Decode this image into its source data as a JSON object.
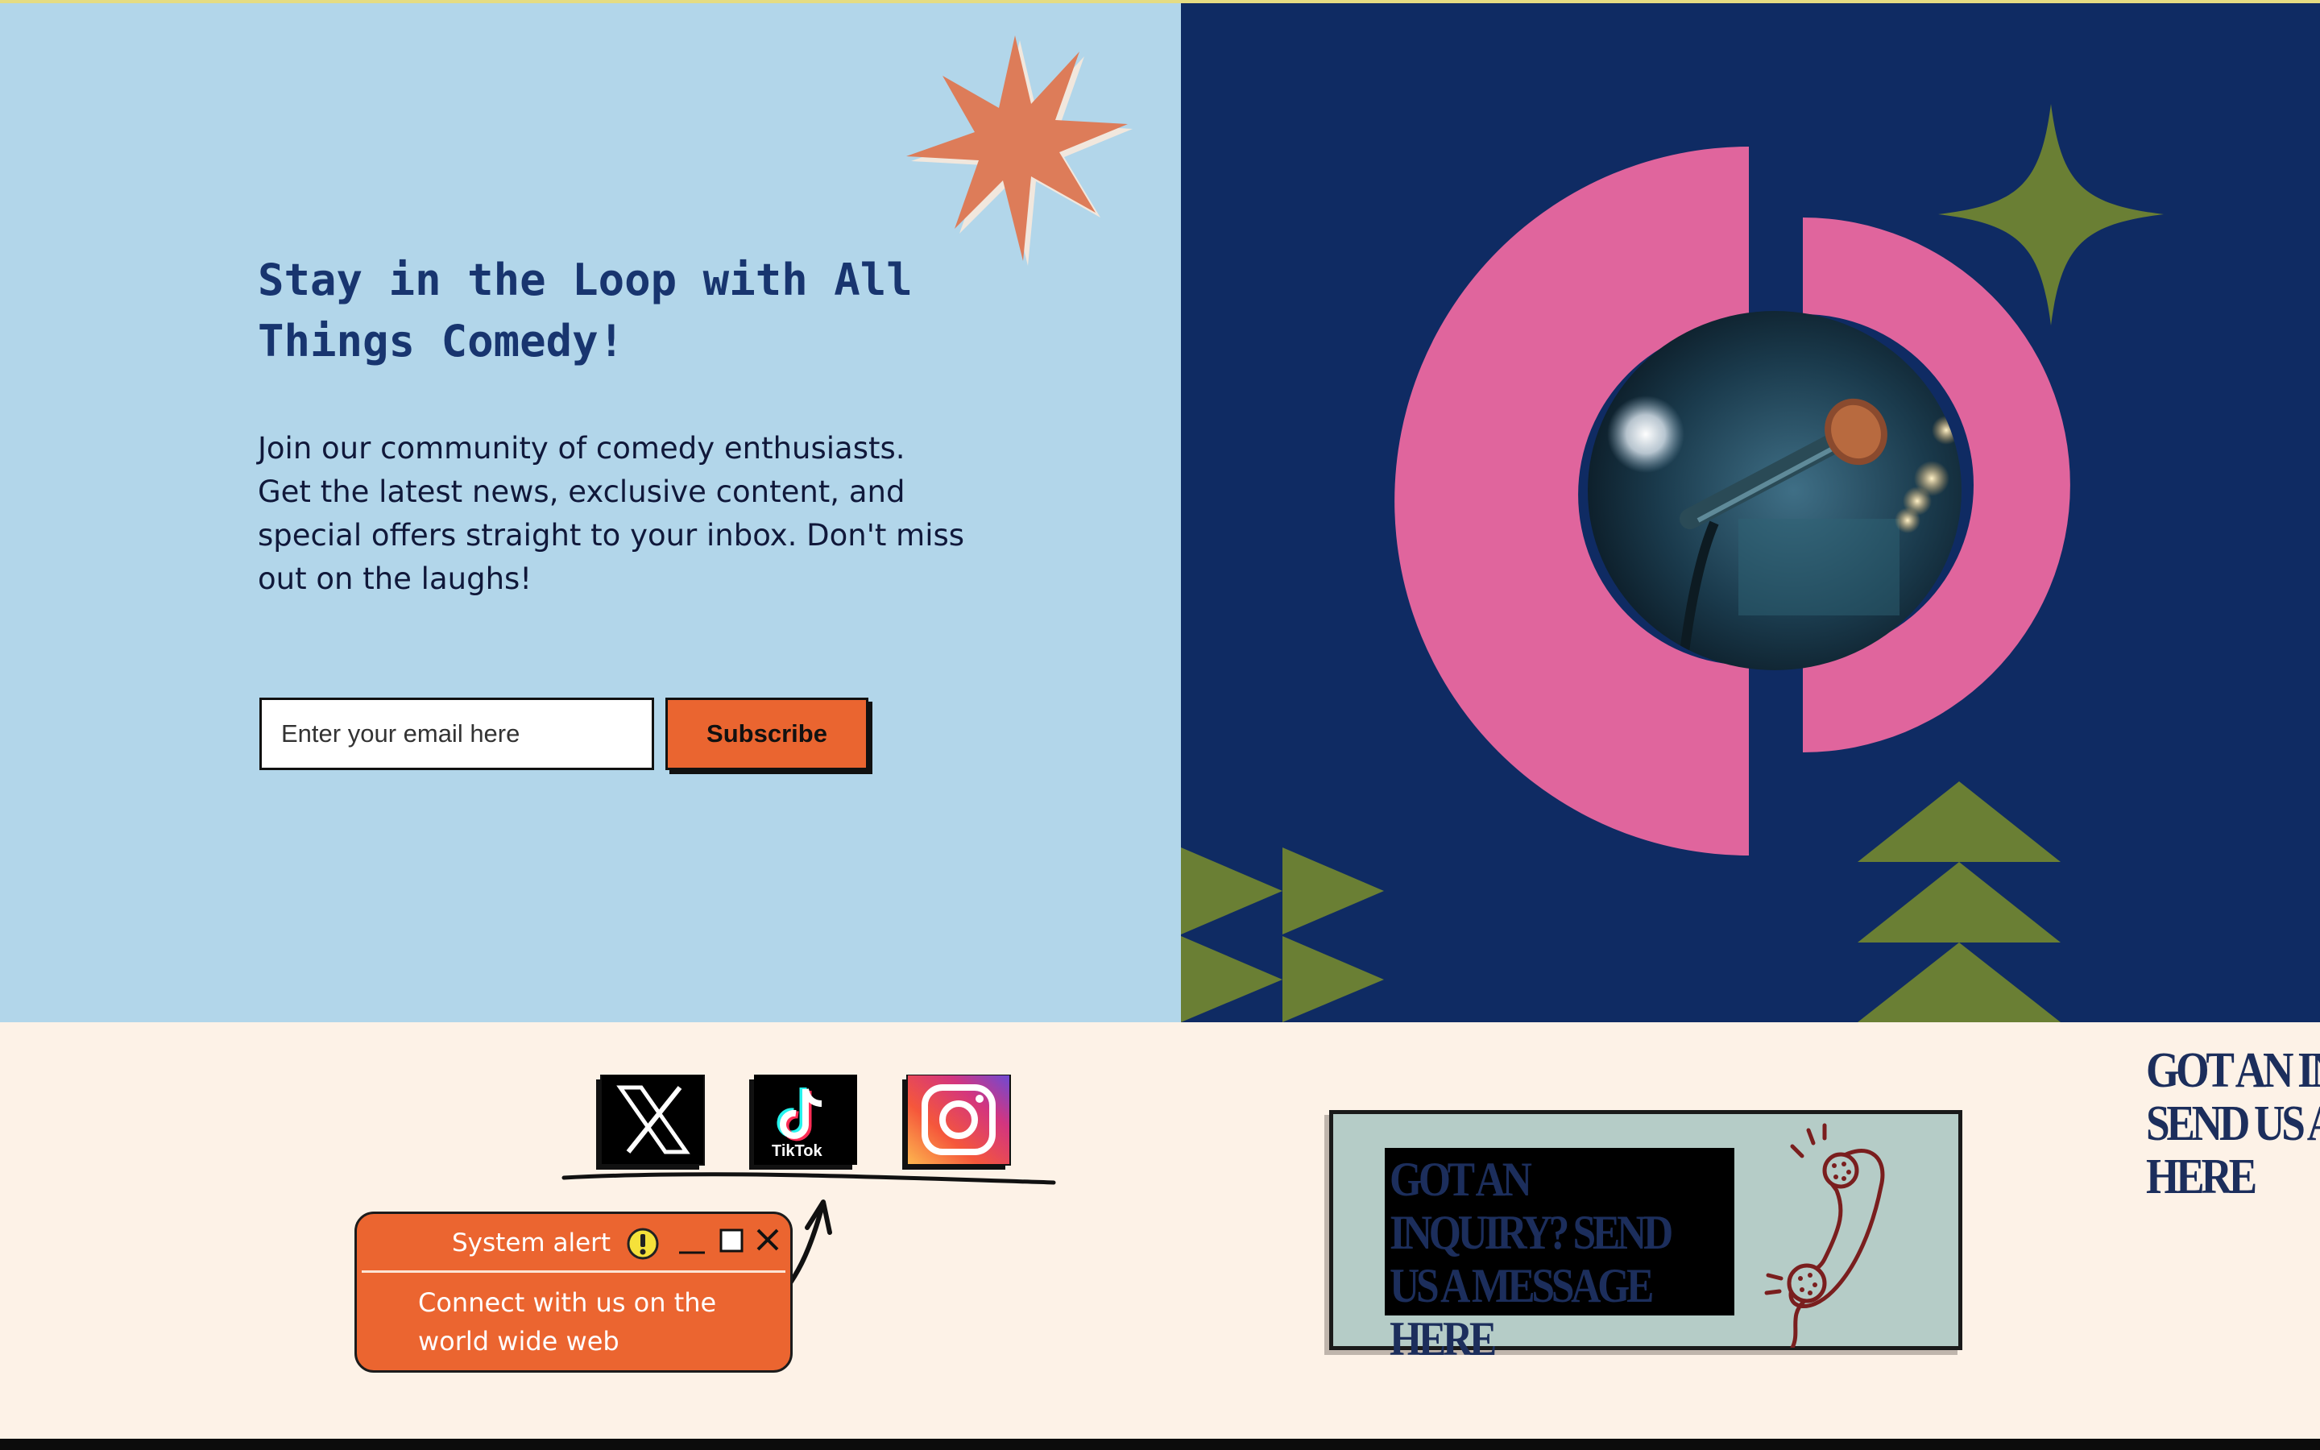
{
  "newsletter": {
    "headline": "Stay in the Loop with All Things Comedy!",
    "body": "Join our community of comedy enthusiasts. Get the latest news, exclusive content, and special offers straight to your inbox. Don't miss out on the laughs!",
    "email_placeholder": "Enter your email here",
    "subscribe_label": "Subscribe"
  },
  "social": {
    "links": [
      {
        "icon": "x-icon"
      },
      {
        "icon": "tiktok-icon",
        "label": "TikTok"
      },
      {
        "icon": "instagram-icon"
      }
    ]
  },
  "alert": {
    "title": "System alert",
    "message": "Connect with us on the world wide web"
  },
  "inquiry": {
    "text": "GOT AN INQUIRY? SEND US A MESSAGE HERE",
    "side_text": "GOT AN INQUIRY? SEND US A MESSAGE HERE"
  },
  "colors": {
    "left_bg": "#b2d6ea",
    "right_bg": "#0f2b63",
    "accent_orange": "#ea6530",
    "pink": "#e0659d",
    "olive": "#6a7f34",
    "cream": "#fdf2e7"
  }
}
